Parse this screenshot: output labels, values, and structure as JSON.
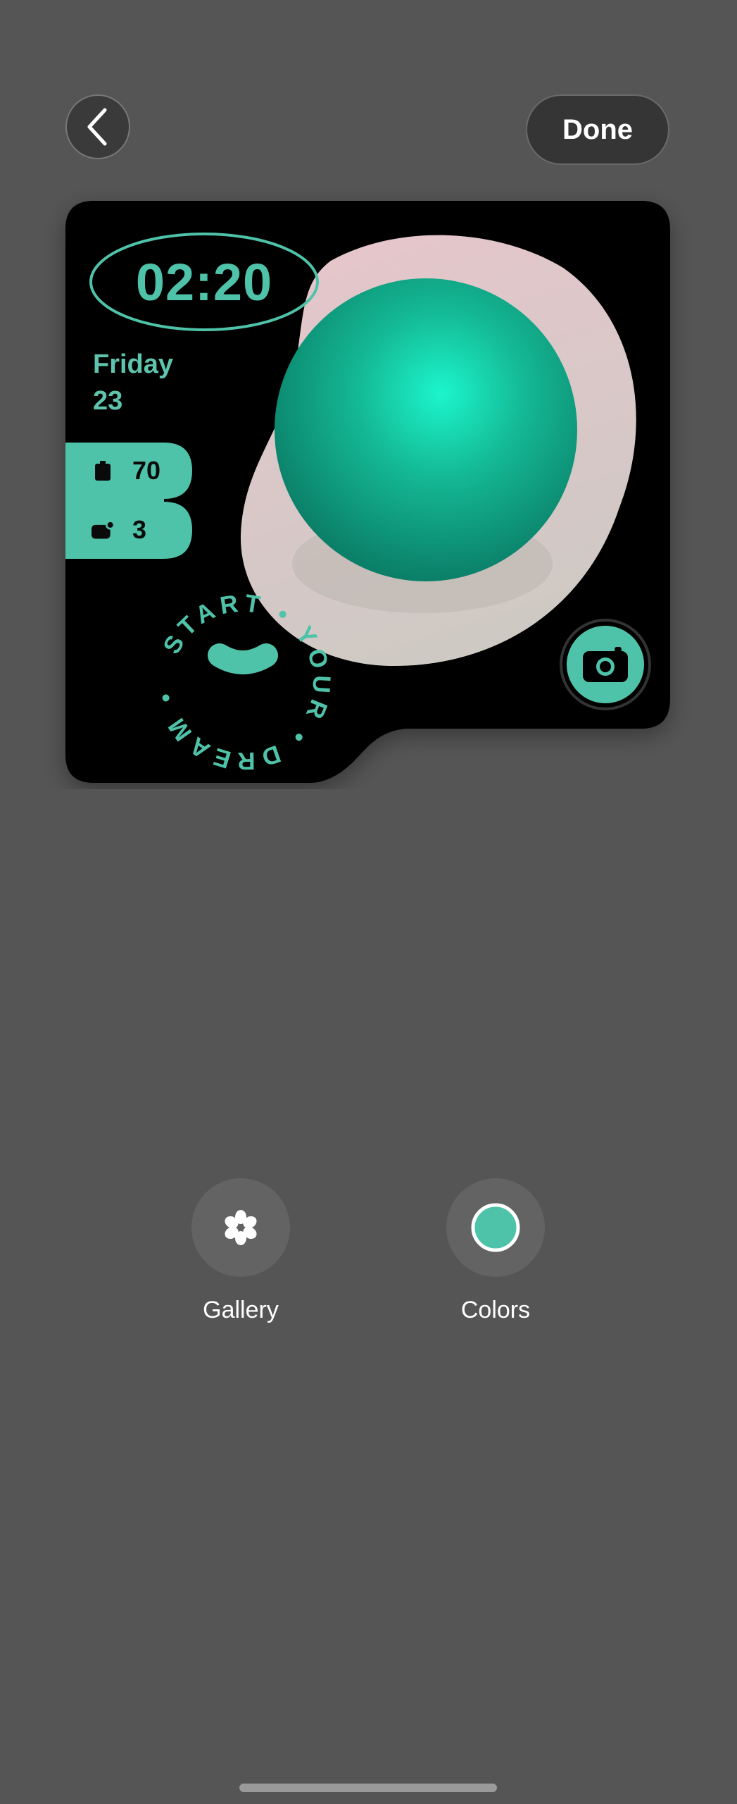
{
  "header": {
    "done_label": "Done"
  },
  "widget": {
    "time": "02:20",
    "day": "Friday",
    "date": "23",
    "battery": "70",
    "notifications": "3",
    "slogan": "START • YOUR • DREAM •",
    "accent_color": "#4fc3a9"
  },
  "actions": [
    {
      "label": "Gallery",
      "icon": "flower-icon"
    },
    {
      "label": "Colors",
      "icon": "color-swatch-icon"
    }
  ]
}
